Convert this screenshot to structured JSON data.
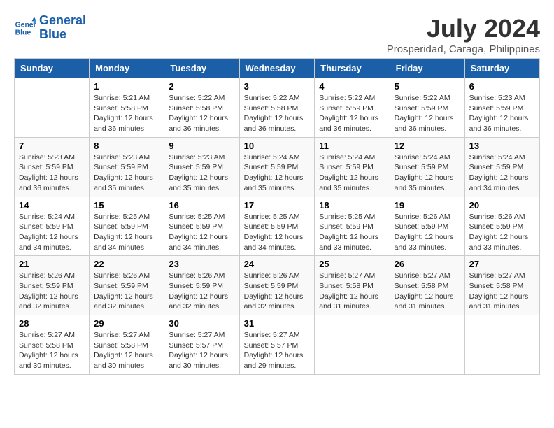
{
  "logo": {
    "line1": "General",
    "line2": "Blue"
  },
  "title": "July 2024",
  "subtitle": "Prosperidad, Caraga, Philippines",
  "days_of_week": [
    "Sunday",
    "Monday",
    "Tuesday",
    "Wednesday",
    "Thursday",
    "Friday",
    "Saturday"
  ],
  "weeks": [
    [
      {
        "day": "",
        "info": ""
      },
      {
        "day": "1",
        "info": "Sunrise: 5:21 AM\nSunset: 5:58 PM\nDaylight: 12 hours\nand 36 minutes."
      },
      {
        "day": "2",
        "info": "Sunrise: 5:22 AM\nSunset: 5:58 PM\nDaylight: 12 hours\nand 36 minutes."
      },
      {
        "day": "3",
        "info": "Sunrise: 5:22 AM\nSunset: 5:58 PM\nDaylight: 12 hours\nand 36 minutes."
      },
      {
        "day": "4",
        "info": "Sunrise: 5:22 AM\nSunset: 5:59 PM\nDaylight: 12 hours\nand 36 minutes."
      },
      {
        "day": "5",
        "info": "Sunrise: 5:22 AM\nSunset: 5:59 PM\nDaylight: 12 hours\nand 36 minutes."
      },
      {
        "day": "6",
        "info": "Sunrise: 5:23 AM\nSunset: 5:59 PM\nDaylight: 12 hours\nand 36 minutes."
      }
    ],
    [
      {
        "day": "7",
        "info": "Sunrise: 5:23 AM\nSunset: 5:59 PM\nDaylight: 12 hours\nand 36 minutes."
      },
      {
        "day": "8",
        "info": "Sunrise: 5:23 AM\nSunset: 5:59 PM\nDaylight: 12 hours\nand 35 minutes."
      },
      {
        "day": "9",
        "info": "Sunrise: 5:23 AM\nSunset: 5:59 PM\nDaylight: 12 hours\nand 35 minutes."
      },
      {
        "day": "10",
        "info": "Sunrise: 5:24 AM\nSunset: 5:59 PM\nDaylight: 12 hours\nand 35 minutes."
      },
      {
        "day": "11",
        "info": "Sunrise: 5:24 AM\nSunset: 5:59 PM\nDaylight: 12 hours\nand 35 minutes."
      },
      {
        "day": "12",
        "info": "Sunrise: 5:24 AM\nSunset: 5:59 PM\nDaylight: 12 hours\nand 35 minutes."
      },
      {
        "day": "13",
        "info": "Sunrise: 5:24 AM\nSunset: 5:59 PM\nDaylight: 12 hours\nand 34 minutes."
      }
    ],
    [
      {
        "day": "14",
        "info": "Sunrise: 5:24 AM\nSunset: 5:59 PM\nDaylight: 12 hours\nand 34 minutes."
      },
      {
        "day": "15",
        "info": "Sunrise: 5:25 AM\nSunset: 5:59 PM\nDaylight: 12 hours\nand 34 minutes."
      },
      {
        "day": "16",
        "info": "Sunrise: 5:25 AM\nSunset: 5:59 PM\nDaylight: 12 hours\nand 34 minutes."
      },
      {
        "day": "17",
        "info": "Sunrise: 5:25 AM\nSunset: 5:59 PM\nDaylight: 12 hours\nand 34 minutes."
      },
      {
        "day": "18",
        "info": "Sunrise: 5:25 AM\nSunset: 5:59 PM\nDaylight: 12 hours\nand 33 minutes."
      },
      {
        "day": "19",
        "info": "Sunrise: 5:26 AM\nSunset: 5:59 PM\nDaylight: 12 hours\nand 33 minutes."
      },
      {
        "day": "20",
        "info": "Sunrise: 5:26 AM\nSunset: 5:59 PM\nDaylight: 12 hours\nand 33 minutes."
      }
    ],
    [
      {
        "day": "21",
        "info": "Sunrise: 5:26 AM\nSunset: 5:59 PM\nDaylight: 12 hours\nand 32 minutes."
      },
      {
        "day": "22",
        "info": "Sunrise: 5:26 AM\nSunset: 5:59 PM\nDaylight: 12 hours\nand 32 minutes."
      },
      {
        "day": "23",
        "info": "Sunrise: 5:26 AM\nSunset: 5:59 PM\nDaylight: 12 hours\nand 32 minutes."
      },
      {
        "day": "24",
        "info": "Sunrise: 5:26 AM\nSunset: 5:59 PM\nDaylight: 12 hours\nand 32 minutes."
      },
      {
        "day": "25",
        "info": "Sunrise: 5:27 AM\nSunset: 5:58 PM\nDaylight: 12 hours\nand 31 minutes."
      },
      {
        "day": "26",
        "info": "Sunrise: 5:27 AM\nSunset: 5:58 PM\nDaylight: 12 hours\nand 31 minutes."
      },
      {
        "day": "27",
        "info": "Sunrise: 5:27 AM\nSunset: 5:58 PM\nDaylight: 12 hours\nand 31 minutes."
      }
    ],
    [
      {
        "day": "28",
        "info": "Sunrise: 5:27 AM\nSunset: 5:58 PM\nDaylight: 12 hours\nand 30 minutes."
      },
      {
        "day": "29",
        "info": "Sunrise: 5:27 AM\nSunset: 5:58 PM\nDaylight: 12 hours\nand 30 minutes."
      },
      {
        "day": "30",
        "info": "Sunrise: 5:27 AM\nSunset: 5:57 PM\nDaylight: 12 hours\nand 30 minutes."
      },
      {
        "day": "31",
        "info": "Sunrise: 5:27 AM\nSunset: 5:57 PM\nDaylight: 12 hours\nand 29 minutes."
      },
      {
        "day": "",
        "info": ""
      },
      {
        "day": "",
        "info": ""
      },
      {
        "day": "",
        "info": ""
      }
    ]
  ]
}
